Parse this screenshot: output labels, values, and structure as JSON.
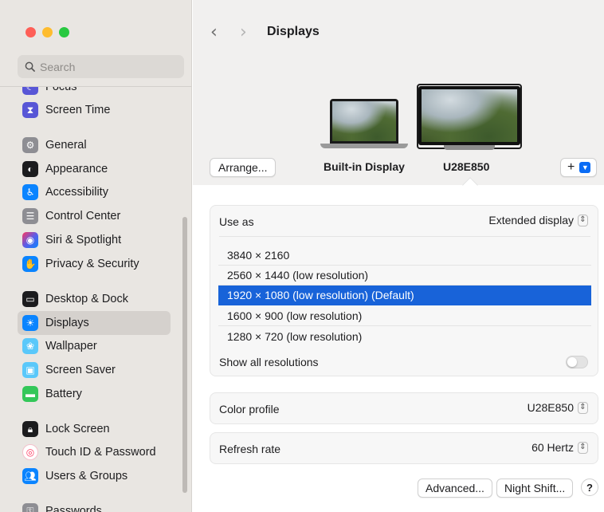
{
  "sidebar": {
    "search": {
      "placeholder": "Search"
    },
    "items": [
      {
        "label": "Focus",
        "icon": "moon-icon",
        "color": "#5856d6"
      },
      {
        "label": "Screen Time",
        "icon": "hourglass-icon",
        "color": "#5856d6"
      },
      {
        "label": "General",
        "icon": "gear-icon",
        "color": "#8e8e93"
      },
      {
        "label": "Appearance",
        "icon": "appearance-icon",
        "color": "#1c1c1e"
      },
      {
        "label": "Accessibility",
        "icon": "accessibility-icon",
        "color": "#0a84ff"
      },
      {
        "label": "Control Center",
        "icon": "control-center-icon",
        "color": "#8e8e93"
      },
      {
        "label": "Siri & Spotlight",
        "icon": "siri-icon",
        "color": "#1c1c1e"
      },
      {
        "label": "Privacy & Security",
        "icon": "hand-icon",
        "color": "#0a84ff"
      },
      {
        "label": "Desktop & Dock",
        "icon": "dock-icon",
        "color": "#1c1c1e"
      },
      {
        "label": "Displays",
        "icon": "sun-icon",
        "color": "#0a84ff"
      },
      {
        "label": "Wallpaper",
        "icon": "flower-icon",
        "color": "#5ac8fa"
      },
      {
        "label": "Screen Saver",
        "icon": "screen-saver-icon",
        "color": "#5ac8fa"
      },
      {
        "label": "Battery",
        "icon": "battery-icon",
        "color": "#34c759"
      },
      {
        "label": "Lock Screen",
        "icon": "lock-icon",
        "color": "#1c1c1e"
      },
      {
        "label": "Touch ID & Password",
        "icon": "fingerprint-icon",
        "color": "#ff375f"
      },
      {
        "label": "Users & Groups",
        "icon": "users-icon",
        "color": "#0a84ff"
      },
      {
        "label": "Passwords",
        "icon": "key-icon",
        "color": "#8e8e93"
      }
    ],
    "selected": "Displays"
  },
  "header": {
    "back": "‹",
    "forward": "›",
    "title": "Displays"
  },
  "displays": {
    "arrange_label": "Arrange...",
    "builtin_label": "Built-in Display",
    "external_label": "U28E850",
    "add_label": "+"
  },
  "use_as": {
    "label": "Use as",
    "value": "Extended display"
  },
  "resolutions": {
    "items": [
      "3840 × 2160",
      "2560 × 1440 (low resolution)",
      "1920 × 1080 (low resolution) (Default)",
      "1600 × 900 (low resolution)",
      "1280 × 720 (low resolution)"
    ],
    "selected_index": 2,
    "show_all_label": "Show all resolutions",
    "show_all_enabled": false
  },
  "color_profile": {
    "label": "Color profile",
    "value": "U28E850"
  },
  "refresh_rate": {
    "label": "Refresh rate",
    "value": "60 Hertz"
  },
  "footer": {
    "advanced_label": "Advanced...",
    "night_shift_label": "Night Shift...",
    "help_label": "?"
  },
  "colors": {
    "accent": "#1863d9",
    "sidebar_bg": "#e9e6e2"
  }
}
